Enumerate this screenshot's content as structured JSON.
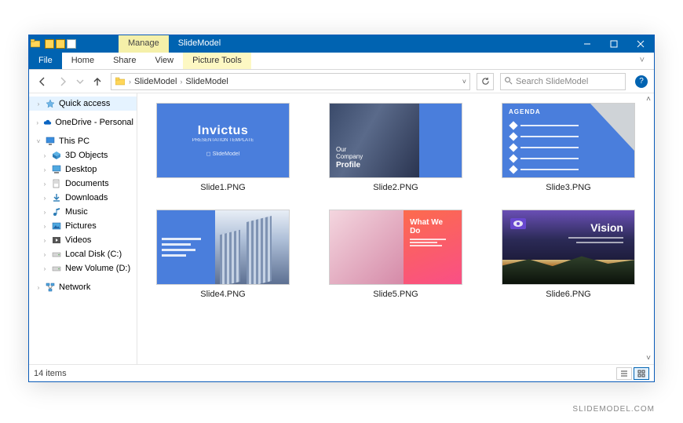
{
  "titlebar": {
    "context_tab": "Manage",
    "title": "SlideModel"
  },
  "ribbon": {
    "file": "File",
    "tabs": [
      "Home",
      "Share",
      "View"
    ],
    "context_tab": "Picture Tools"
  },
  "nav": {
    "breadcrumb": [
      "SlideModel",
      "SlideModel"
    ],
    "search_placeholder": "Search SlideModel"
  },
  "tree": {
    "quick_access": "Quick access",
    "onedrive": "OneDrive - Personal",
    "this_pc": "This PC",
    "children": [
      "3D Objects",
      "Desktop",
      "Documents",
      "Downloads",
      "Music",
      "Pictures",
      "Videos",
      "Local Disk (C:)",
      "New Volume (D:)"
    ],
    "network": "Network"
  },
  "files": [
    {
      "name": "Slide1.PNG"
    },
    {
      "name": "Slide2.PNG"
    },
    {
      "name": "Slide3.PNG"
    },
    {
      "name": "Slide4.PNG"
    },
    {
      "name": "Slide5.PNG"
    },
    {
      "name": "Slide6.PNG"
    }
  ],
  "thumb_text": {
    "t1_title": "Invictus",
    "t1_sub": "PRESENTATION TEMPLATE",
    "t1_brand": "SlideModel",
    "t2_l1": "Our",
    "t2_l2": "Company",
    "t2_l3": "Profile",
    "t3_header": "AGENDA",
    "t5_header": "What We Do",
    "t6_title": "Vision"
  },
  "status": {
    "count": "14 items"
  },
  "watermark": "SLIDEMODEL.COM"
}
